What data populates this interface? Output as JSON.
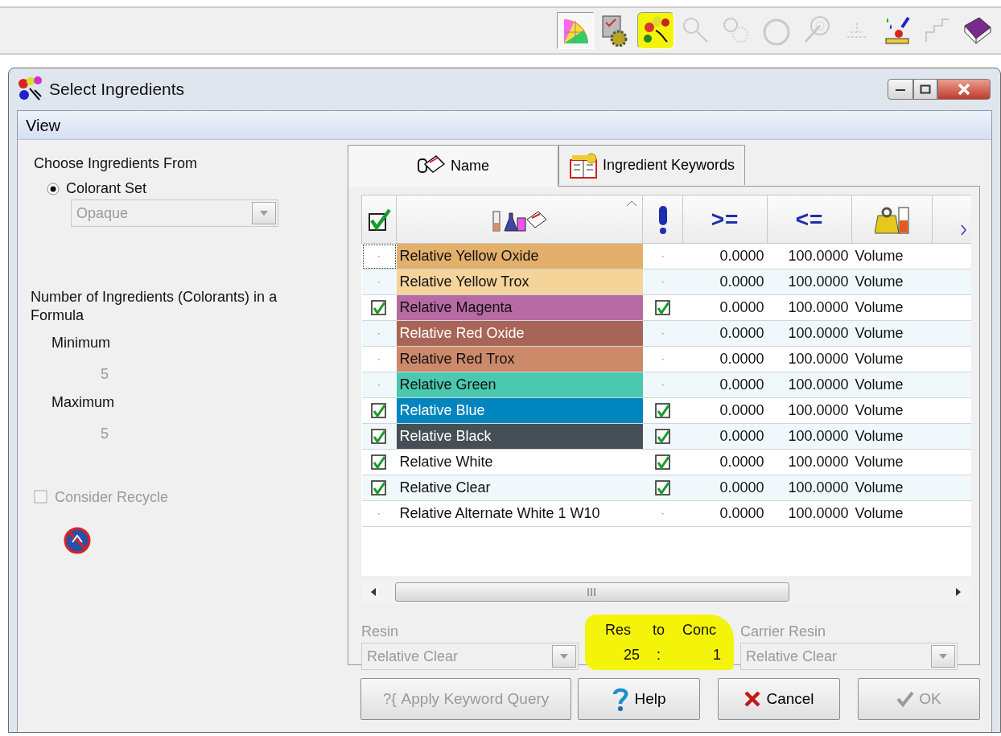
{
  "toolbar": {
    "buttons": [
      {
        "pressed": true,
        "disabled": false,
        "highlighted": false
      },
      {
        "pressed": false,
        "disabled": false,
        "highlighted": false
      },
      {
        "pressed": true,
        "disabled": false,
        "highlighted": true
      },
      {
        "pressed": false,
        "disabled": true,
        "highlighted": false
      },
      {
        "pressed": false,
        "disabled": true,
        "highlighted": false
      },
      {
        "pressed": false,
        "disabled": true,
        "highlighted": false
      },
      {
        "pressed": false,
        "disabled": true,
        "highlighted": false
      },
      {
        "pressed": false,
        "disabled": true,
        "highlighted": false
      },
      {
        "pressed": false,
        "disabled": false,
        "highlighted": false
      },
      {
        "pressed": false,
        "disabled": true,
        "highlighted": false
      },
      {
        "pressed": false,
        "disabled": false,
        "highlighted": false
      }
    ]
  },
  "window": {
    "title": "Select Ingredients"
  },
  "menu": [
    "View"
  ],
  "left": {
    "source_heading": "Choose Ingredients From",
    "source_option": {
      "label": "Colorant Set",
      "selected": true
    },
    "colorant_set": {
      "value": "Opaque",
      "disabled": true
    },
    "count_heading": "Number of Ingredients (Colorants) in a Formula",
    "minimum": {
      "label": "Minimum",
      "value": "5"
    },
    "maximum": {
      "label": "Maximum",
      "value": "5"
    },
    "recycle": {
      "label": "Consider Recycle",
      "checked": false,
      "disabled": true
    }
  },
  "tabs": [
    {
      "label": "Name",
      "selected": true
    },
    {
      "label": "Ingredient Keywords",
      "selected": false
    }
  ],
  "table": {
    "columns": [
      {
        "kind": "check"
      },
      {
        "kind": "name"
      },
      {
        "kind": "required"
      },
      {
        "kind": "text",
        "label": ">="
      },
      {
        "kind": "text",
        "label": "<="
      },
      {
        "kind": "units"
      },
      {
        "kind": "more"
      }
    ],
    "rows": [
      {
        "name": "Relative Yellow Oxide",
        "color": "#e3b06c",
        "included": false,
        "required": false,
        "min": "0.0000",
        "max": "100.0000",
        "units": "Volume",
        "focused": true
      },
      {
        "name": "Relative Yellow Trox",
        "color": "#f5d49a",
        "included": false,
        "required": false,
        "min": "0.0000",
        "max": "100.0000",
        "units": "Volume",
        "focused": false
      },
      {
        "name": "Relative Magenta",
        "color": "#b86aa4",
        "included": true,
        "required": true,
        "min": "0.0000",
        "max": "100.0000",
        "units": "Volume",
        "focused": false
      },
      {
        "name": "Relative Red Oxide",
        "color": "#a86456",
        "included": false,
        "required": false,
        "min": "0.0000",
        "max": "100.0000",
        "units": "Volume",
        "focused": false
      },
      {
        "name": "Relative Red Trox",
        "color": "#cd8a6a",
        "included": false,
        "required": false,
        "min": "0.0000",
        "max": "100.0000",
        "units": "Volume",
        "focused": false
      },
      {
        "name": "Relative Green",
        "color": "#4ac8b0",
        "included": false,
        "required": false,
        "min": "0.0000",
        "max": "100.0000",
        "units": "Volume",
        "focused": false
      },
      {
        "name": "Relative Blue",
        "color": "#0085bf",
        "included": true,
        "required": true,
        "min": "0.0000",
        "max": "100.0000",
        "units": "Volume",
        "focused": false
      },
      {
        "name": "Relative Black",
        "color": "#464f55",
        "included": true,
        "required": true,
        "min": "0.0000",
        "max": "100.0000",
        "units": "Volume",
        "focused": false
      },
      {
        "name": "Relative White",
        "included": true,
        "required": true,
        "min": "0.0000",
        "max": "100.0000",
        "units": "Volume",
        "focused": false
      },
      {
        "name": "Relative Clear",
        "included": true,
        "required": true,
        "min": "0.0000",
        "max": "100.0000",
        "units": "Volume",
        "focused": false
      },
      {
        "name": "Relative Alternate White 1 W10",
        "included": false,
        "required": false,
        "min": "0.0000",
        "max": "100.0000",
        "units": "Volume",
        "focused": false
      }
    ]
  },
  "ratio": {
    "resin_label": "Resin",
    "resin": "Relative Clear",
    "res_label": "Res",
    "to_label": "to",
    "conc_label": "Conc",
    "res_value": "25",
    "separator": ":",
    "conc_value": "1",
    "carrier_label": "Carrier Resin",
    "carrier": "Relative Clear",
    "disabled": true,
    "highlighted": true
  },
  "buttons": [
    {
      "kind": "query",
      "icon_text": "?{",
      "label": "Apply Keyword Query",
      "disabled": true
    },
    {
      "kind": "help",
      "label": "Help",
      "disabled": false
    },
    {
      "kind": "cancel",
      "label": "Cancel",
      "disabled": false
    },
    {
      "kind": "ok",
      "label": "OK",
      "disabled": true
    }
  ]
}
